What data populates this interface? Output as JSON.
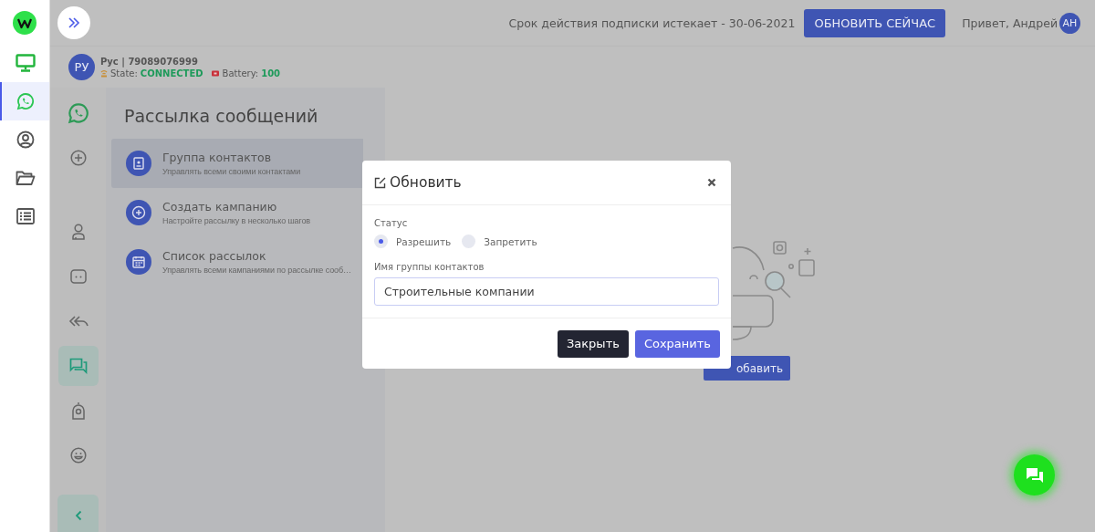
{
  "sidebar": {
    "items": [
      {
        "selected": false
      },
      {
        "selected": true
      },
      {
        "selected": false
      },
      {
        "selected": false
      },
      {
        "selected": false
      }
    ]
  },
  "topbar": {
    "notice": "Срок действия подписки истекает - 30-06-2021",
    "renew_button": "ОБНОВИТЬ СЕЙЧАС",
    "greeting": "Привет, Андрей",
    "avatar": "АН"
  },
  "account": {
    "avatar": "РУ",
    "name": "Рус | 79089076999",
    "state_label": "State:",
    "state": "CONNECTED",
    "battery_label": "Battery:",
    "battery": "100"
  },
  "rail": {
    "items": [
      {
        "kind": "whatsapp",
        "selected": false
      },
      {
        "kind": "plus",
        "selected": false
      },
      {
        "kind": "person",
        "selected": false
      },
      {
        "kind": "bot",
        "selected": false
      },
      {
        "kind": "reply",
        "selected": false
      },
      {
        "kind": "chat",
        "selected": true
      },
      {
        "kind": "camera",
        "selected": false
      },
      {
        "kind": "emoji",
        "selected": false
      }
    ]
  },
  "menu": {
    "title": "Рассылка сообщений",
    "items": [
      {
        "kind": "contacts",
        "title": "Группа контактов",
        "subtitle": "Управлять всеми своими контактами",
        "selected": true
      },
      {
        "kind": "plus",
        "title": "Создать кампанию",
        "subtitle": "Настройте рассылку в несколько шагов",
        "selected": false
      },
      {
        "kind": "calendar",
        "title": "Список рассылок",
        "subtitle": "Управлять всеми кампаниями по рассылке сооб…",
        "selected": false
      }
    ]
  },
  "empty_state": {
    "add_button": "обавить"
  },
  "modal": {
    "title": "Обновить",
    "status_label": "Статус",
    "radios": [
      {
        "label": "Разрешить",
        "selected": true
      },
      {
        "label": "Запретить",
        "selected": false
      }
    ],
    "field_label": "Имя группы контактов",
    "field_value": "Строительные компании",
    "buttons": [
      {
        "kind": "dark",
        "label": "Закрыть"
      },
      {
        "kind": "primary",
        "label": "Сохранить"
      }
    ]
  }
}
